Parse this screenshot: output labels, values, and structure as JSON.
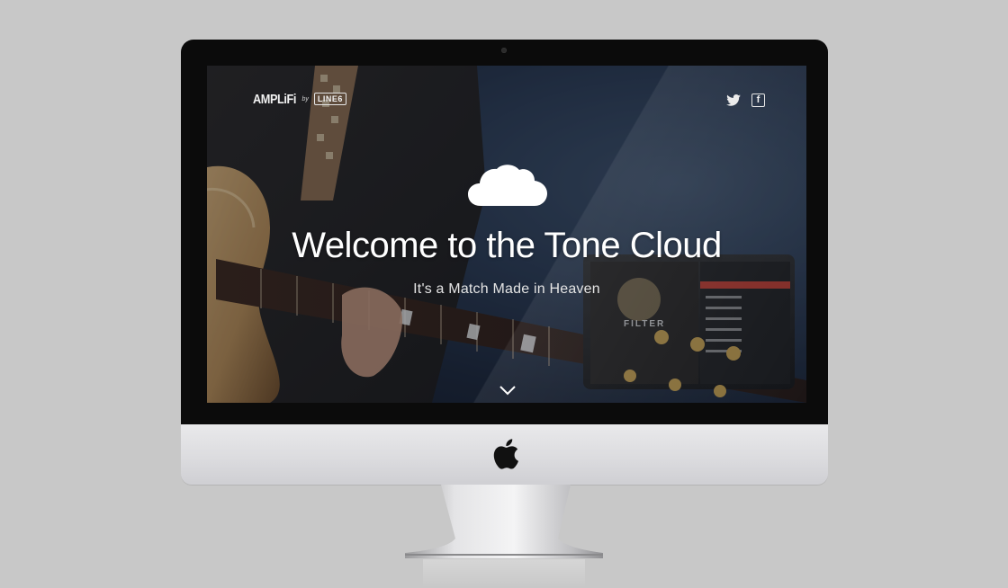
{
  "site": {
    "brand": {
      "name": "AMPLiFi",
      "by": "by",
      "partner": "LINE6"
    },
    "social": {
      "twitter_icon": "twitter-icon",
      "facebook_icon": "facebook-icon",
      "facebook_glyph": "f"
    },
    "hero": {
      "icon": "cloud-icon",
      "title": "Welcome to the Tone Cloud",
      "subtitle": "It's a Match Made in Heaven",
      "scroll_icon": "chevron-down-icon"
    },
    "tablet": {
      "album_text": "FILTER"
    }
  },
  "device": {
    "logo_icon": "apple-logo-icon"
  },
  "colors": {
    "bezel": "#0b0b0b",
    "chin": "#dcdcdf",
    "background": "#c8c8c8",
    "screen_overlay": "#1a2436",
    "text_primary": "#ffffff"
  }
}
